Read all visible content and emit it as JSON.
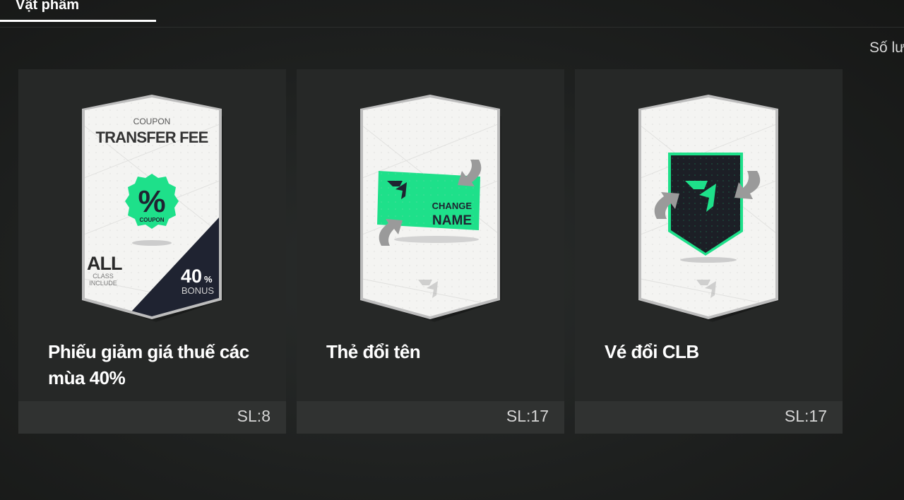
{
  "tab": {
    "label": "Vật phẩm"
  },
  "sort": {
    "label": "Số lượ"
  },
  "items": [
    {
      "title": "Phiếu giảm giá thuế các mùa 40%",
      "qty": "SL:8",
      "art": {
        "coupon_small": "COUPON",
        "coupon_big": "TRANSFER FEE",
        "badge_symbol": "%",
        "badge_text": "COUPON",
        "all": "ALL",
        "class_line1": "CLASS",
        "class_line2": "INCLUDE",
        "bonus_value": "40",
        "bonus_unit": "%",
        "bonus_text": "BONUS"
      }
    },
    {
      "title": "Thẻ đổi tên",
      "qty": "SL:17",
      "art": {
        "line1": "CHANGE",
        "line2": "NAME"
      }
    },
    {
      "title": "Vé đổi CLB",
      "qty": "SL:17",
      "art": {}
    }
  ],
  "colors": {
    "accent_green": "#1ee08a",
    "card_bg": "#262827",
    "card_footer": "#303231",
    "dark_navy": "#1f2331"
  }
}
